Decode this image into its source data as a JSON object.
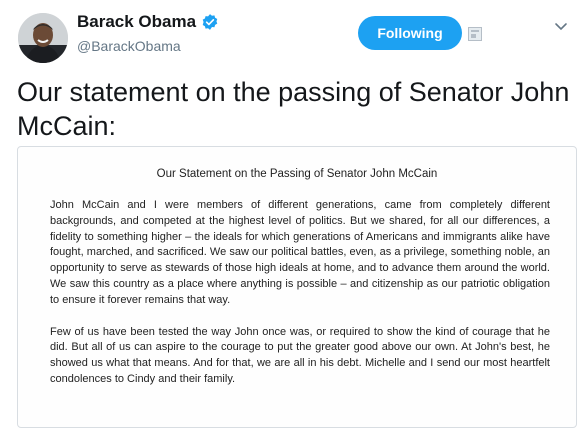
{
  "header": {
    "name": "Barack Obama",
    "handle": "@BarackObama",
    "follow_label": "Following"
  },
  "colors": {
    "accent": "#1da1f2",
    "verified": "#1da1f2",
    "secondary_text": "#657786"
  },
  "icons": {
    "verified": "verified-badge-icon",
    "tweetdeck": "tweetdeck-icon",
    "more": "chevron-down-icon"
  },
  "tweet": {
    "text": "Our statement on the passing of Senator John McCain:"
  },
  "statement": {
    "title": "Our Statement on the Passing of Senator John McCain",
    "paragraph1": "John McCain and I were members of different generations, came from completely different backgrounds, and competed at the highest level of politics. But we shared, for all our differences, a fidelity to something higher – the ideals for which generations of Americans and immigrants alike have fought, marched, and sacrificed. We saw our political battles, even, as a privilege, something noble, an opportunity to serve as stewards of those high ideals at home, and to advance them around the world. We saw this country as a place where anything is possible – and citizenship as our patriotic obligation to ensure it forever remains that way.",
    "paragraph2": "Few of us have been tested the way John once was, or required to show the kind of courage that he did. But all of us can aspire to the courage to put the greater good above our own. At John's best, he showed us what that means. And for that, we are all in his debt. Michelle and I send our most heartfelt condolences to Cindy and their family."
  }
}
